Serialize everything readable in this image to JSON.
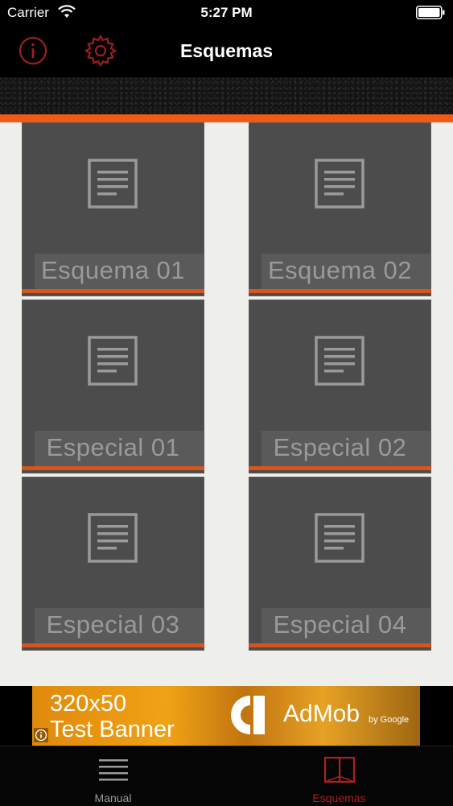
{
  "status_bar": {
    "carrier": "Carrier",
    "time": "5:27 PM"
  },
  "nav_bar": {
    "title": "Esquemas"
  },
  "tiles": [
    {
      "label": "Esquema 01"
    },
    {
      "label": "Esquema 02"
    },
    {
      "label": "Especial 01"
    },
    {
      "label": "Especial 02"
    },
    {
      "label": "Especial 03"
    },
    {
      "label": "Especial 04"
    }
  ],
  "ad": {
    "line1": "320x50",
    "line2": "Test Banner",
    "brand": "AdMob",
    "by": "by Google"
  },
  "tab_bar": {
    "tabs": [
      {
        "label": "Manual",
        "icon": "menu-lines-icon",
        "active": false
      },
      {
        "label": "Esquemas",
        "icon": "book-icon",
        "active": true
      }
    ]
  },
  "colors": {
    "accent_orange": "#ef5a16",
    "nav_icon_red": "#9c1f1f",
    "tab_active": "#b01f1f",
    "tab_inactive": "#9a9a9a",
    "tile_bg": "#4c4c4c",
    "content_bg": "#eeeeea"
  }
}
